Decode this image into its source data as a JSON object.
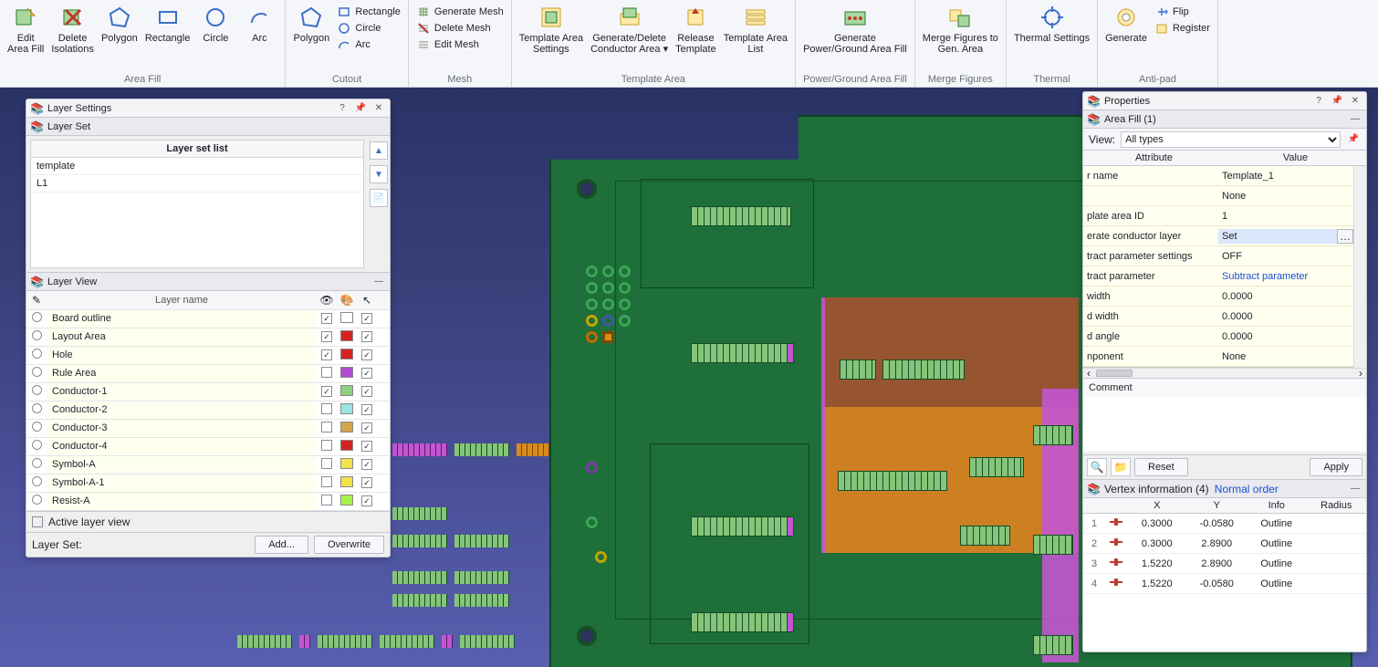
{
  "ribbon": {
    "groups": [
      {
        "cap": "Area Fill",
        "items": [
          {
            "k": "big",
            "name": "edit-area-fill",
            "label": "Edit\nArea Fill"
          },
          {
            "k": "big",
            "name": "delete-isolations",
            "label": "Delete\nIsolations"
          },
          {
            "k": "big",
            "name": "polygon",
            "label": "Polygon"
          },
          {
            "k": "big",
            "name": "rectangle",
            "label": "Rectangle"
          },
          {
            "k": "big",
            "name": "circle",
            "label": "Circle"
          },
          {
            "k": "big",
            "name": "arc",
            "label": "Arc"
          }
        ]
      },
      {
        "cap": "Cutout",
        "items": [
          {
            "k": "big",
            "name": "cutout-polygon",
            "label": "Polygon"
          },
          {
            "k": "col",
            "rows": [
              {
                "name": "cutout-rectangle",
                "label": "Rectangle"
              },
              {
                "name": "cutout-circle",
                "label": "Circle"
              },
              {
                "name": "cutout-arc",
                "label": "Arc"
              }
            ]
          }
        ]
      },
      {
        "cap": "Mesh",
        "items": [
          {
            "k": "col",
            "rows": [
              {
                "name": "generate-mesh",
                "label": "Generate Mesh"
              },
              {
                "name": "delete-mesh",
                "label": "Delete Mesh"
              },
              {
                "name": "edit-mesh",
                "label": "Edit Mesh"
              }
            ]
          }
        ]
      },
      {
        "cap": "Template Area",
        "items": [
          {
            "k": "big",
            "name": "template-area-settings",
            "label": "Template Area\nSettings"
          },
          {
            "k": "big",
            "name": "generate-delete-conductor-area",
            "label": "Generate/Delete\nConductor Area ▾"
          },
          {
            "k": "big",
            "name": "release-template",
            "label": "Release\nTemplate"
          },
          {
            "k": "big",
            "name": "template-area-list",
            "label": "Template Area\nList"
          }
        ]
      },
      {
        "cap": "Power/Ground Area Fill",
        "items": [
          {
            "k": "big",
            "name": "generate-pg-area-fill",
            "label": "Generate\nPower/Ground Area Fill"
          }
        ]
      },
      {
        "cap": "Merge Figures",
        "items": [
          {
            "k": "big",
            "name": "merge-figures-to-gen-area",
            "label": "Merge Figures to\nGen. Area"
          }
        ]
      },
      {
        "cap": "Thermal",
        "items": [
          {
            "k": "big",
            "name": "thermal-settings",
            "label": "Thermal Settings"
          }
        ]
      },
      {
        "cap": "Anti-pad",
        "items": [
          {
            "k": "big",
            "name": "antipad-generate",
            "label": "Generate"
          },
          {
            "k": "col",
            "rows": [
              {
                "name": "antipad-flip",
                "label": "Flip"
              },
              {
                "name": "antipad-register",
                "label": "Register"
              }
            ]
          }
        ]
      }
    ]
  },
  "layer_settings": {
    "title": "Layer Settings",
    "subtitle": "Layer Set",
    "list_header": "Layer set list",
    "rows": [
      "template",
      "L1"
    ]
  },
  "layer_view": {
    "title": "Layer View",
    "columns": {
      "name": "Layer name"
    },
    "rows": [
      {
        "name": "Board outline",
        "v": true,
        "color": "#ffffff",
        "s": true
      },
      {
        "name": "Layout Area",
        "v": true,
        "color": "#d62222",
        "s": true
      },
      {
        "name": "Hole",
        "v": true,
        "color": "#d62222",
        "s": true
      },
      {
        "name": "Rule Area",
        "v": false,
        "color": "#b24bd6",
        "s": true
      },
      {
        "name": "Conductor-1",
        "v": true,
        "color": "#8ed07e",
        "s": true
      },
      {
        "name": "Conductor-2",
        "v": false,
        "color": "#9be3e0",
        "s": true
      },
      {
        "name": "Conductor-3",
        "v": false,
        "color": "#d6a24b",
        "s": true
      },
      {
        "name": "Conductor-4",
        "v": false,
        "color": "#d62222",
        "s": true
      },
      {
        "name": "Symbol-A",
        "v": false,
        "color": "#f2e34b",
        "s": true
      },
      {
        "name": "Symbol-A-1",
        "v": false,
        "color": "#f2e34b",
        "s": true
      },
      {
        "name": "Resist-A",
        "v": false,
        "color": "#a6f24b",
        "s": true
      }
    ],
    "active_label": "Active layer view",
    "layer_set_label": "Layer Set:",
    "add_btn": "Add...",
    "overwrite_btn": "Overwrite"
  },
  "properties": {
    "title": "Properties",
    "section": "Area Fill (1)",
    "view_label": "View:",
    "view_value": "All types",
    "col_a": "Attribute",
    "col_v": "Value",
    "rows": [
      {
        "a": "r name",
        "v": "Template_1"
      },
      {
        "a": "",
        "v": "None"
      },
      {
        "a": "plate area ID",
        "v": "1"
      },
      {
        "a": "erate conductor layer",
        "v": "Set",
        "sel": true
      },
      {
        "a": "tract parameter settings",
        "v": "OFF"
      },
      {
        "a": "tract parameter",
        "v": "Subtract parameter",
        "link": true
      },
      {
        "a": "width",
        "v": "0.0000"
      },
      {
        "a": "d width",
        "v": "0.0000"
      },
      {
        "a": "d angle",
        "v": "0.0000"
      },
      {
        "a": "nponent",
        "v": "None"
      }
    ],
    "comment_label": "Comment",
    "reset_btn": "Reset",
    "apply_btn": "Apply",
    "vertex_title": "Vertex information (4)",
    "vertex_order": "Normal order",
    "vcols": {
      "x": "X",
      "y": "Y",
      "info": "Info",
      "r": "Radius"
    },
    "vrows": [
      {
        "i": "1",
        "x": "0.3000",
        "y": "-0.0580",
        "info": "Outline",
        "r": ""
      },
      {
        "i": "2",
        "x": "0.3000",
        "y": "2.8900",
        "info": "Outline",
        "r": ""
      },
      {
        "i": "3",
        "x": "1.5220",
        "y": "2.8900",
        "info": "Outline",
        "r": ""
      },
      {
        "i": "4",
        "x": "1.5220",
        "y": "-0.0580",
        "info": "Outline",
        "r": ""
      }
    ]
  }
}
